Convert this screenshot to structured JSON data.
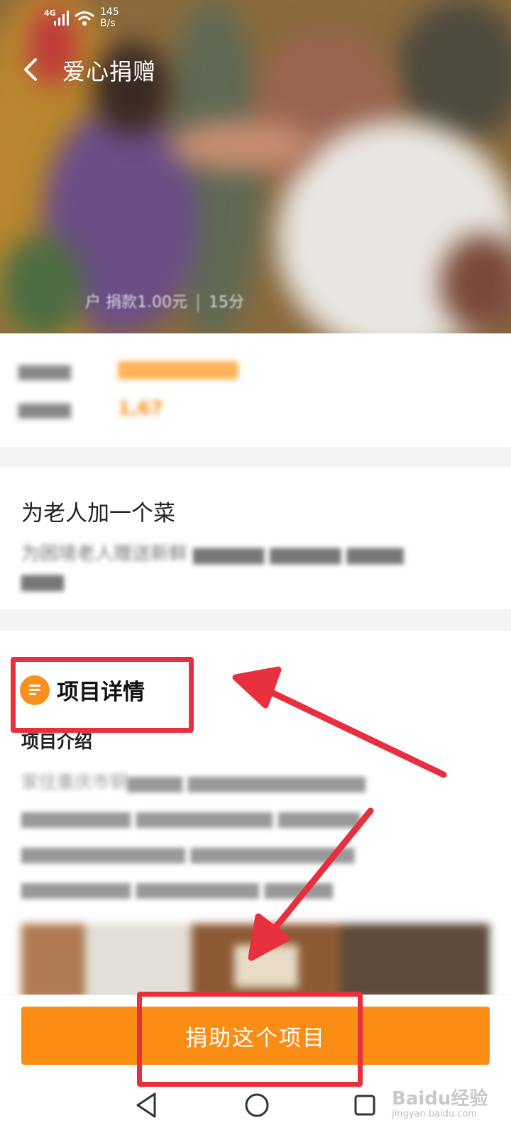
{
  "status_bar": {
    "network": "4G",
    "speed_value": "145",
    "speed_unit": "B/s"
  },
  "header": {
    "title": "爱心捐赠",
    "back_icon": "chevron-left-icon"
  },
  "hero": {
    "donation_ticker": "户 捐款1.00元",
    "ticker_time": "15分"
  },
  "stats": {
    "count_value": "1,67"
  },
  "project": {
    "title": "为老人加一个菜",
    "subtitle": "为困境老人赠送新鲜"
  },
  "details": {
    "heading": "项目详情",
    "icon": "document-icon",
    "intro_label": "项目介绍",
    "intro_text": "家住重庆市铜"
  },
  "actions": {
    "donate_label": "捐助这个项目",
    "primary_color": "#fb8c14"
  },
  "navigation": {
    "back_icon": "triangle-back-icon",
    "home_icon": "circle-home-icon",
    "recent_icon": "square-recent-icon"
  },
  "annotations": {
    "highlight_color": "#e7303d"
  },
  "watermark": {
    "brand": "Baidu经验",
    "url": "jingyan.baidu.com"
  }
}
